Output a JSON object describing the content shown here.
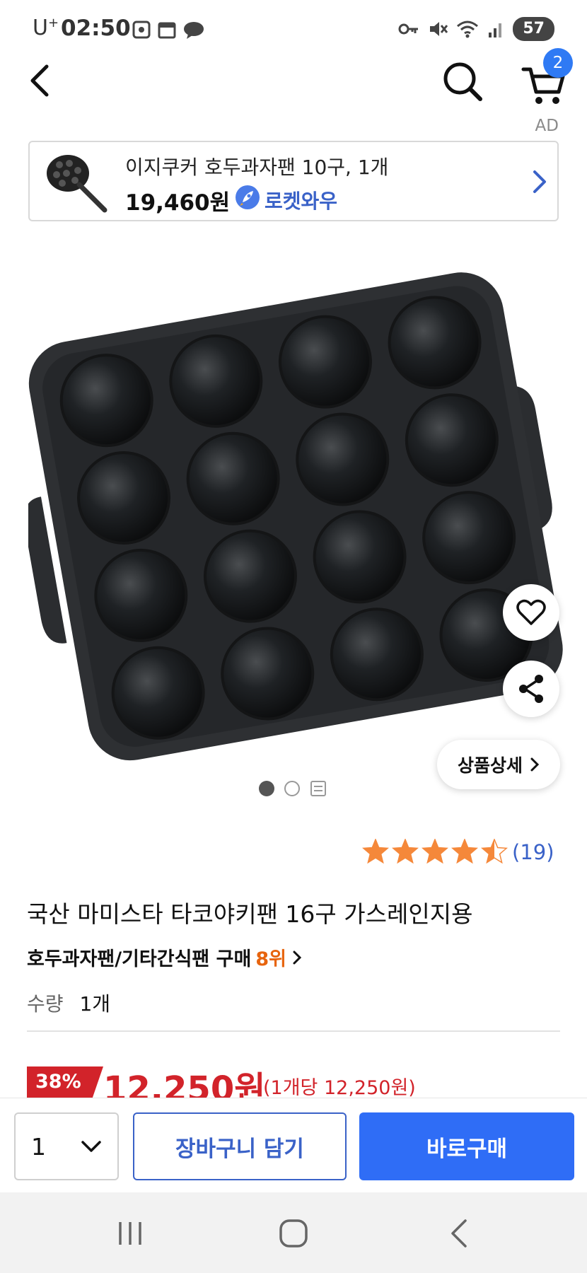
{
  "status_bar": {
    "carrier": "U",
    "carrier_sup": "+",
    "time": "02:50",
    "battery": "57"
  },
  "header": {
    "cart_count": "2",
    "ad_label": "AD"
  },
  "ad_card": {
    "title": "이지쿠커 호두과자팬 10구, 1개",
    "price": "19,460원",
    "rocket_label": "로켓와우"
  },
  "product": {
    "detail_button": "상품상세",
    "rating": 4.5,
    "review_count": "(19)",
    "title": "국산 마미스타 타코야키팬 16구 가스레인지용",
    "rank_category": "호두과자팬/기타간식팬 구매",
    "rank": "8위",
    "quantity_label": "수량",
    "quantity_value": "1개",
    "discount": "38%",
    "sale_price": "12,250원",
    "unit_price": "(1개당 12,250원)"
  },
  "bottom_bar": {
    "quantity": "1",
    "add_to_cart": "장바구니 담기",
    "buy_now": "바로구매"
  },
  "colors": {
    "accent_blue": "#2f6df6",
    "price_red": "#d2232a",
    "rank_orange": "#e7640e",
    "star_orange": "#f5883a"
  }
}
